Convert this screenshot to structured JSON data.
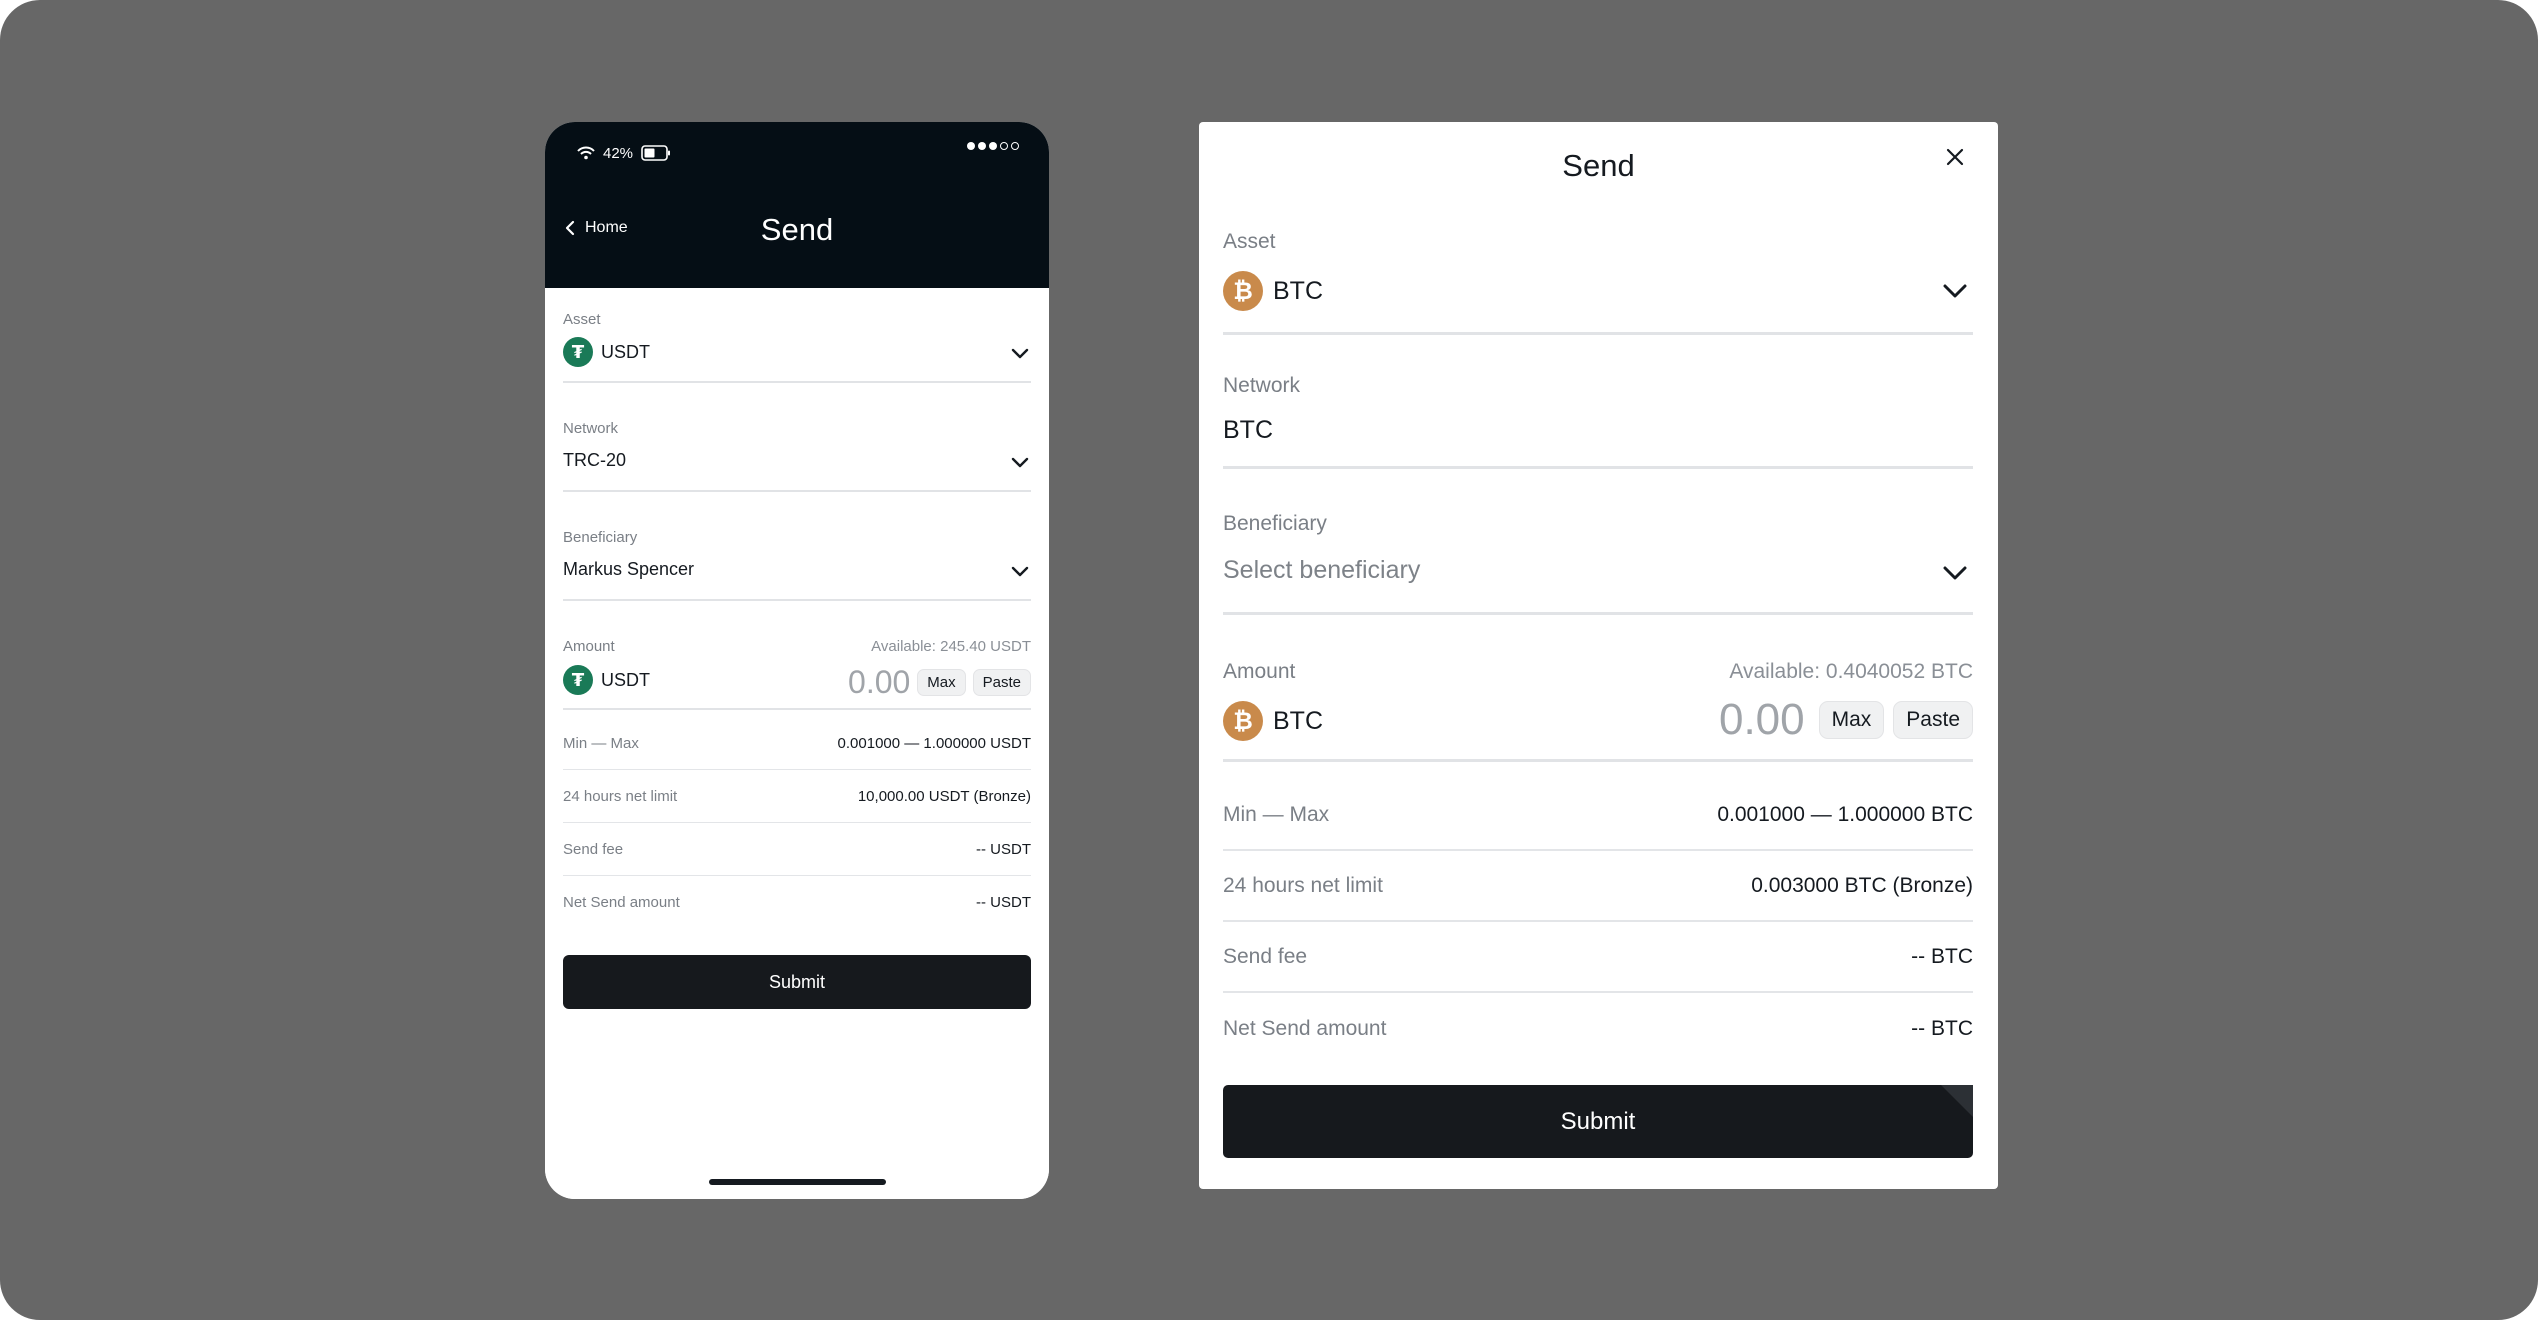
{
  "colors": {
    "backdrop": "#676767",
    "phone_header": "#050e15",
    "submit_bg": "#16191d",
    "usdt_green": "#1a7a57",
    "btc_orange": "#c98a4b"
  },
  "mobile": {
    "status": {
      "wifi_icon": "wifi-icon",
      "battery_percent": "42%",
      "battery_icon": "battery-icon",
      "signal_icon": "signal-dots-icon"
    },
    "nav": {
      "back_label": "Home",
      "back_icon": "chevron-left-icon"
    },
    "title": "Send",
    "asset": {
      "label": "Asset",
      "value": "USDT",
      "coin_glyph": "₮"
    },
    "network": {
      "label": "Network",
      "value": "TRC-20"
    },
    "beneficiary": {
      "label": "Beneficiary",
      "value": "Markus Spencer"
    },
    "amount": {
      "label": "Amount",
      "available": "Available: 245.40 USDT",
      "currency": "USDT",
      "coin_glyph": "₮",
      "value": "0.00",
      "max_label": "Max",
      "paste_label": "Paste"
    },
    "details": [
      {
        "key": "Min — Max",
        "value": "0.001000 — 1.000000 USDT"
      },
      {
        "key": "24 hours net limit",
        "value": "10,000.00 USDT (Bronze)"
      },
      {
        "key": "Send fee",
        "value": "-- USDT"
      },
      {
        "key": "Net Send amount",
        "value": "-- USDT"
      }
    ],
    "submit_label": "Submit"
  },
  "dialog": {
    "title": "Send",
    "close_icon": "close-icon",
    "asset": {
      "label": "Asset",
      "value": "BTC",
      "coin_glyph": "₿"
    },
    "network": {
      "label": "Network",
      "value": "BTC"
    },
    "beneficiary": {
      "label": "Beneficiary",
      "placeholder": "Select beneficiary"
    },
    "amount": {
      "label": "Amount",
      "available": "Available: 0.4040052 BTC",
      "currency": "BTC",
      "coin_glyph": "₿",
      "value": "0.00",
      "max_label": "Max",
      "paste_label": "Paste"
    },
    "details": [
      {
        "key": "Min — Max",
        "value": "0.001000 — 1.000000 BTC"
      },
      {
        "key": "24 hours net limit",
        "value": "0.003000 BTC (Bronze)"
      },
      {
        "key": "Send fee",
        "value": "-- BTC"
      },
      {
        "key": "Net Send amount",
        "value": "-- BTC"
      }
    ],
    "submit_label": "Submit"
  }
}
